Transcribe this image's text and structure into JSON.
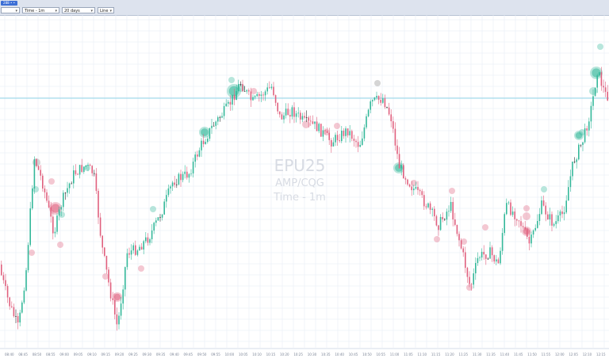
{
  "toolbar": {
    "app_badge": "288 • • 7/9",
    "time_frame": "Time - 1m",
    "lookback": "20 days",
    "chart_style": "Line",
    "dropdown_icon": "chevron-down-icon"
  },
  "watermark": {
    "symbol": "EPU25",
    "source": "AMP/CQG",
    "interval": "Time - 1m"
  },
  "colors": {
    "up": "#34b89a",
    "down": "#e0607e",
    "neutral": "#333333",
    "grid": "#e6ecf6",
    "price_line": "#6fc8e0"
  },
  "chart_data": {
    "type": "candlestick",
    "x_tick_labels": [
      "08:40",
      "08:45",
      "08:50",
      "08:55",
      "09:00",
      "09:05",
      "09:10",
      "09:15",
      "09:20",
      "09:25",
      "09:30",
      "09:35",
      "09:40",
      "09:45",
      "09:50",
      "09:55",
      "10:00",
      "10:05",
      "10:10",
      "10:15",
      "10:20",
      "10:25",
      "10:30",
      "10:35",
      "10:40",
      "10:45",
      "10:50",
      "10:55",
      "11:00",
      "11:05",
      "11:10",
      "11:15",
      "11:20",
      "11:25",
      "11:30",
      "11:35",
      "11:40",
      "11:45",
      "11:50",
      "11:55",
      "12:00",
      "12:05",
      "12:10",
      "12:15"
    ],
    "grid": true,
    "markers": "volume bubbles"
  }
}
